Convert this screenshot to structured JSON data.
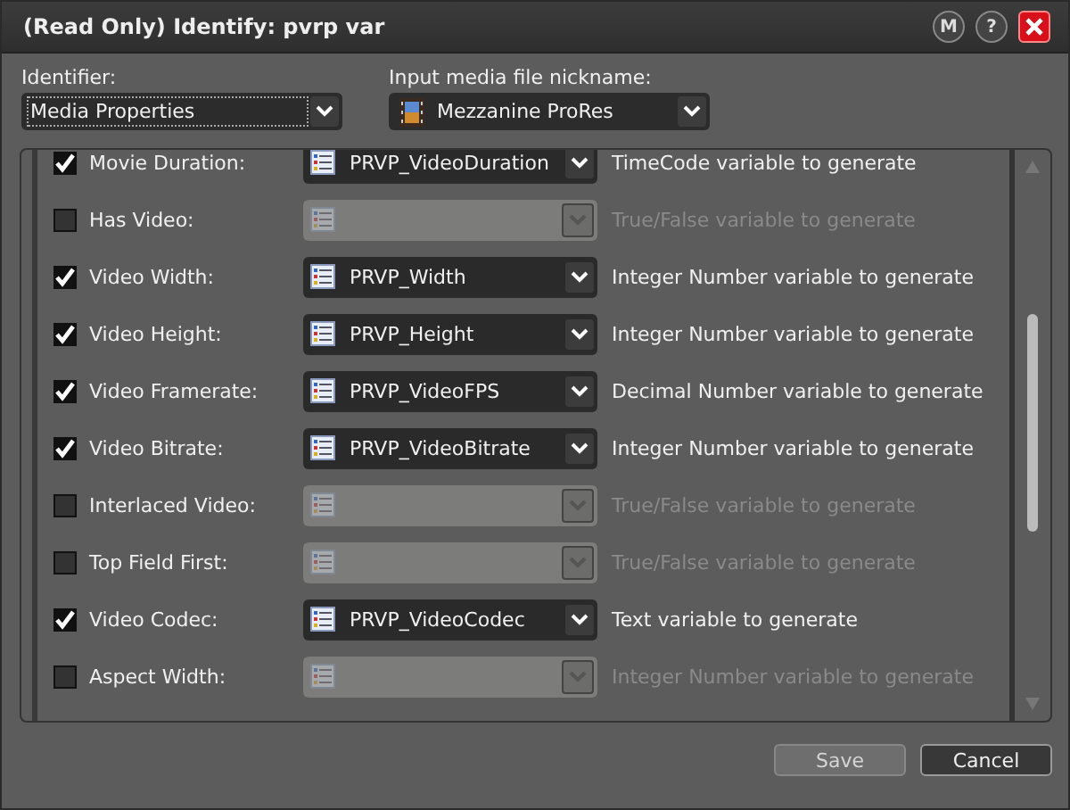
{
  "window": {
    "title": "(Read Only) Identify: pvrp var",
    "buttons": [
      {
        "kind": "m",
        "label": "M"
      },
      {
        "kind": "help",
        "label": "?"
      },
      {
        "kind": "close"
      }
    ]
  },
  "identifier": {
    "label": "Identifier:",
    "value": "Media Properties"
  },
  "nickname": {
    "label": "Input media file nickname:",
    "value": "Mezzanine ProRes"
  },
  "rows": [
    {
      "label": "Movie Duration:",
      "checked": true,
      "variable": "PRVP_VideoDuration",
      "description": "TimeCode variable to generate"
    },
    {
      "label": "Has Video:",
      "checked": false,
      "description": "True/False variable to generate"
    },
    {
      "label": "Video Width:",
      "checked": true,
      "variable": "PRVP_Width",
      "description": "Integer Number variable to generate"
    },
    {
      "label": "Video Height:",
      "checked": true,
      "variable": "PRVP_Height",
      "description": "Integer Number variable to generate"
    },
    {
      "label": "Video Framerate:",
      "checked": true,
      "variable": "PRVP_VideoFPS",
      "description": "Decimal Number variable to generate"
    },
    {
      "label": "Video Bitrate:",
      "checked": true,
      "variable": "PRVP_VideoBitrate",
      "description": "Integer Number variable to generate"
    },
    {
      "label": "Interlaced Video:",
      "checked": false,
      "description": "True/False variable to generate"
    },
    {
      "label": "Top Field First:",
      "checked": false,
      "description": "True/False variable to generate"
    },
    {
      "label": "Video Codec:",
      "checked": true,
      "variable": "PRVP_VideoCodec",
      "description": "Text variable to generate"
    },
    {
      "label": "Aspect Width:",
      "checked": false,
      "description": "Integer Number variable to generate"
    }
  ],
  "footer": [
    {
      "label": "Save",
      "disabled": true
    },
    {
      "label": "Cancel",
      "disabled": false
    }
  ]
}
